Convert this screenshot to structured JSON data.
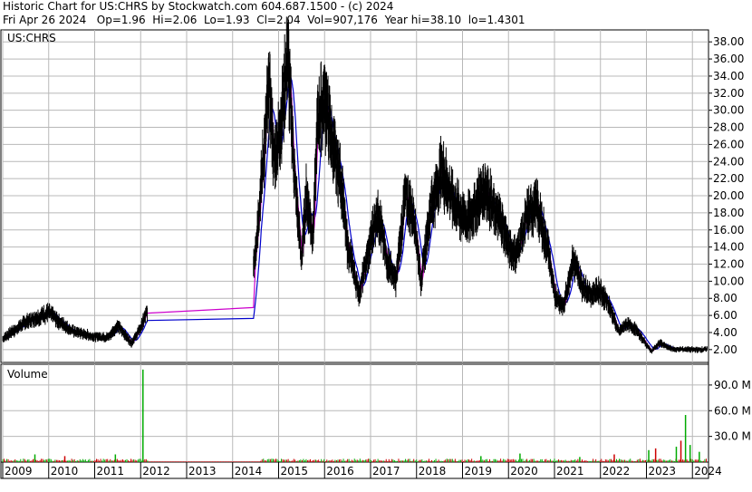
{
  "header": {
    "line1": "Historic Chart for US:CHRS by Stockwatch.com 604.687.1500 - (c) 2024",
    "line2": "Fri Apr 26 2024   Op=1.96  Hi=2.06  Lo=1.93  Cl=2.04  Vol=907,176  Year hi=38.10  lo=1.4301"
  },
  "colors": {
    "price": "#000000",
    "ma_short": "#cc00cc",
    "ma_long": "#0000cc",
    "vol_up": "#00aa00",
    "vol_down": "#cc0000",
    "grid": "#b8b8b8"
  },
  "chart_data": [
    {
      "type": "line",
      "label": "US:CHRS",
      "ylim": [
        0.5,
        39.4
      ],
      "yticks": [
        "38.00",
        "36.00",
        "34.00",
        "32.00",
        "30.00",
        "28.00",
        "26.00",
        "24.00",
        "22.00",
        "20.00",
        "18.00",
        "16.00",
        "14.00",
        "12.00",
        "10.00",
        "8.00",
        "6.00",
        "4.00",
        "2.00"
      ],
      "ytick_values": [
        38,
        36,
        34,
        32,
        30,
        28,
        26,
        24,
        22,
        20,
        18,
        16,
        14,
        12,
        10,
        8,
        6,
        4,
        2
      ],
      "x": [
        2009.0,
        2009.5,
        2010.0,
        2010.5,
        2011.0,
        2011.3,
        2011.5,
        2011.8,
        2012.0,
        2012.15,
        2014.45,
        2014.6,
        2014.8,
        2014.9,
        2015.0,
        2015.2,
        2015.35,
        2015.5,
        2015.6,
        2015.75,
        2015.85,
        2016.0,
        2016.2,
        2016.35,
        2016.5,
        2016.6,
        2016.75,
        2017.0,
        2017.15,
        2017.35,
        2017.55,
        2017.75,
        2017.95,
        2018.1,
        2018.3,
        2018.55,
        2018.75,
        2018.9,
        2019.1,
        2019.3,
        2019.5,
        2019.7,
        2019.85,
        2020.0,
        2020.15,
        2020.4,
        2020.6,
        2020.85,
        2021.0,
        2021.2,
        2021.4,
        2021.6,
        2021.8,
        2022.0,
        2022.2,
        2022.4,
        2022.55,
        2022.75,
        2022.95,
        2023.1,
        2023.3,
        2023.45,
        2023.6,
        2023.8,
        2024.0,
        2024.2,
        2024.32
      ],
      "close": [
        3.3,
        5.2,
        6.3,
        4.2,
        3.5,
        3.5,
        4.8,
        2.8,
        4.5,
        6.6,
        11.0,
        20.0,
        33.0,
        24.0,
        26.5,
        36.5,
        22.0,
        12.5,
        20.0,
        15.5,
        29.0,
        31.5,
        25.0,
        22.0,
        14.0,
        12.0,
        8.5,
        14.5,
        18.5,
        12.5,
        10.0,
        20.0,
        17.5,
        10.0,
        18.5,
        23.0,
        20.0,
        18.5,
        17.0,
        19.0,
        21.0,
        18.0,
        17.0,
        14.0,
        13.0,
        17.5,
        19.0,
        14.0,
        8.5,
        7.0,
        12.5,
        9.5,
        8.5,
        9.0,
        7.0,
        4.0,
        5.0,
        4.5,
        3.0,
        1.8,
        2.8,
        2.3,
        2.04,
        2.04,
        2.0,
        2.0,
        2.04
      ],
      "series": [
        {
          "name": "",
          "legend": false
        }
      ]
    },
    {
      "type": "bar",
      "label": "Volume",
      "ylim": [
        0,
        110
      ],
      "yticks": [
        "90.0 M",
        "60.0 M",
        "30.0 M"
      ],
      "ytick_values": [
        90,
        60,
        30
      ],
      "spikes": [
        {
          "x": 2012.05,
          "value": 108,
          "dir": "up"
        },
        {
          "x": 2023.85,
          "value": 55,
          "dir": "up"
        },
        {
          "x": 2023.75,
          "value": 25,
          "dir": "down"
        },
        {
          "x": 2023.95,
          "value": 20,
          "dir": "up"
        },
        {
          "x": 2023.65,
          "value": 18,
          "dir": "up"
        },
        {
          "x": 2023.2,
          "value": 16,
          "dir": "down"
        },
        {
          "x": 2023.05,
          "value": 14,
          "dir": "up"
        },
        {
          "x": 2011.45,
          "value": 9,
          "dir": "up"
        },
        {
          "x": 2009.7,
          "value": 9,
          "dir": "up"
        },
        {
          "x": 2010.35,
          "value": 7,
          "dir": "down"
        },
        {
          "x": 2019.4,
          "value": 7,
          "dir": "up"
        },
        {
          "x": 2020.25,
          "value": 10,
          "dir": "up"
        },
        {
          "x": 2021.55,
          "value": 6,
          "dir": "up"
        },
        {
          "x": 2022.3,
          "value": 9,
          "dir": "down"
        },
        {
          "x": 2024.15,
          "value": 12,
          "dir": "up"
        }
      ]
    }
  ],
  "xaxis": {
    "ticks": [
      "2009",
      "2010",
      "2011",
      "2012",
      "2013",
      "2014",
      "2015",
      "2016",
      "2017",
      "2018",
      "2019",
      "2020",
      "2021",
      "2022",
      "2023",
      "2024"
    ],
    "tick_values": [
      2009,
      2010,
      2011,
      2012,
      2013,
      2014,
      2015,
      2016,
      2017,
      2018,
      2019,
      2020,
      2021,
      2022,
      2023,
      2024
    ],
    "range": [
      2009.0,
      2024.35
    ]
  }
}
